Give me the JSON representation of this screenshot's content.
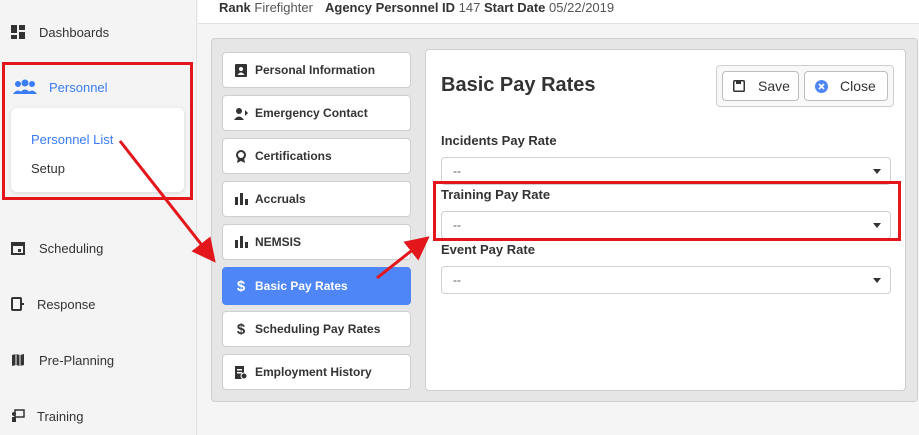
{
  "sidebar": {
    "items": [
      {
        "label": "Dashboards",
        "icon": "dashboard-icon"
      },
      {
        "label": "Personnel",
        "icon": "people-icon"
      },
      {
        "label": "Scheduling",
        "icon": "calendar-icon"
      },
      {
        "label": "Response",
        "icon": "response-icon"
      },
      {
        "label": "Pre-Planning",
        "icon": "map-icon"
      },
      {
        "label": "Training",
        "icon": "training-icon"
      }
    ],
    "submenu": [
      {
        "label": "Personnel List"
      },
      {
        "label": "Setup"
      }
    ]
  },
  "header": {
    "rank_label": "Rank",
    "rank_value": "Firefighter",
    "agency_id_label": "Agency Personnel ID",
    "agency_id_value": "147",
    "start_date_label": "Start Date",
    "start_date_value": "05/22/2019"
  },
  "tabs": [
    {
      "label": "Personal Information",
      "icon": "id-card-icon"
    },
    {
      "label": "Emergency Contact",
      "icon": "contact-icon"
    },
    {
      "label": "Certifications",
      "icon": "award-icon"
    },
    {
      "label": "Accruals",
      "icon": "bar-chart-icon"
    },
    {
      "label": "NEMSIS",
      "icon": "bar-chart-icon"
    },
    {
      "label": "Basic Pay Rates",
      "icon": "dollar-icon"
    },
    {
      "label": "Scheduling Pay Rates",
      "icon": "dollar-icon"
    },
    {
      "label": "Employment History",
      "icon": "history-icon"
    }
  ],
  "form": {
    "title": "Basic Pay Rates",
    "save_label": "Save",
    "close_label": "Close",
    "fields": [
      {
        "label": "Incidents Pay Rate",
        "value": "--"
      },
      {
        "label": "Training Pay Rate",
        "value": "--"
      },
      {
        "label": "Event Pay Rate",
        "value": "--"
      }
    ]
  },
  "colors": {
    "accent": "#4e86f8",
    "link": "#3a7cf5",
    "highlight": "#e3161b"
  }
}
